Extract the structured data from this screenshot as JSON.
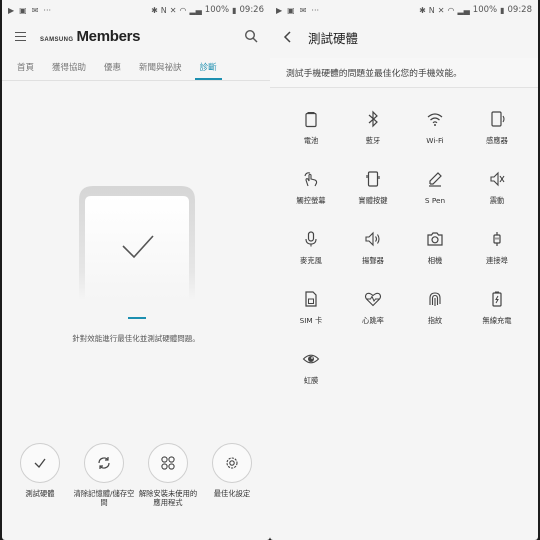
{
  "left": {
    "status": {
      "icons": [
        "play-icon",
        "image-icon",
        "notification-icon",
        "more-icon"
      ],
      "battery": "100%",
      "time": "09:26"
    },
    "brand": {
      "samsung": "SAMSUNG",
      "members": "Members"
    },
    "tabs": [
      {
        "label": "首頁",
        "active": false
      },
      {
        "label": "獲得協助",
        "active": false
      },
      {
        "label": "優惠",
        "active": false
      },
      {
        "label": "新聞與祕訣",
        "active": false
      },
      {
        "label": "診斷",
        "active": true
      }
    ],
    "caption": "針對效能進行最佳化並測試硬體問題。",
    "actions": [
      {
        "label": "測試硬體",
        "icon": "check-icon"
      },
      {
        "label": "清除記憶體/儲存空間",
        "icon": "refresh-icon"
      },
      {
        "label": "解除安裝未使用的應用程式",
        "icon": "apps-grid-icon"
      },
      {
        "label": "最佳化設定",
        "icon": "gear-icon"
      }
    ]
  },
  "right": {
    "status": {
      "battery": "100%",
      "time": "09:28"
    },
    "title": "測試硬體",
    "description": "測試手機硬體的問題並最佳化您的手機效能。",
    "tests": [
      {
        "label": "電池",
        "icon": "battery-icon"
      },
      {
        "label": "藍牙",
        "icon": "bluetooth-icon"
      },
      {
        "label": "Wi-Fi",
        "icon": "wifi-icon"
      },
      {
        "label": "感應器",
        "icon": "sensor-icon"
      },
      {
        "label": "觸控螢幕",
        "icon": "touch-icon"
      },
      {
        "label": "實體按鍵",
        "icon": "phone-keys-icon"
      },
      {
        "label": "S Pen",
        "icon": "pen-icon"
      },
      {
        "label": "震動",
        "icon": "vibration-icon"
      },
      {
        "label": "麥克風",
        "icon": "microphone-icon"
      },
      {
        "label": "揚聲器",
        "icon": "speaker-icon"
      },
      {
        "label": "相機",
        "icon": "camera-icon"
      },
      {
        "label": "連接埠",
        "icon": "connector-icon"
      },
      {
        "label": "SIM 卡",
        "icon": "sim-card-icon"
      },
      {
        "label": "心跳率",
        "icon": "heart-rate-icon"
      },
      {
        "label": "指紋",
        "icon": "fingerprint-icon"
      },
      {
        "label": "無線充電",
        "icon": "wireless-charging-icon"
      },
      {
        "label": "虹膜",
        "icon": "iris-icon"
      }
    ]
  },
  "colors": {
    "accent": "#1c8fb0",
    "background": "#f5f5f5",
    "divider": "#1c1c1c"
  }
}
